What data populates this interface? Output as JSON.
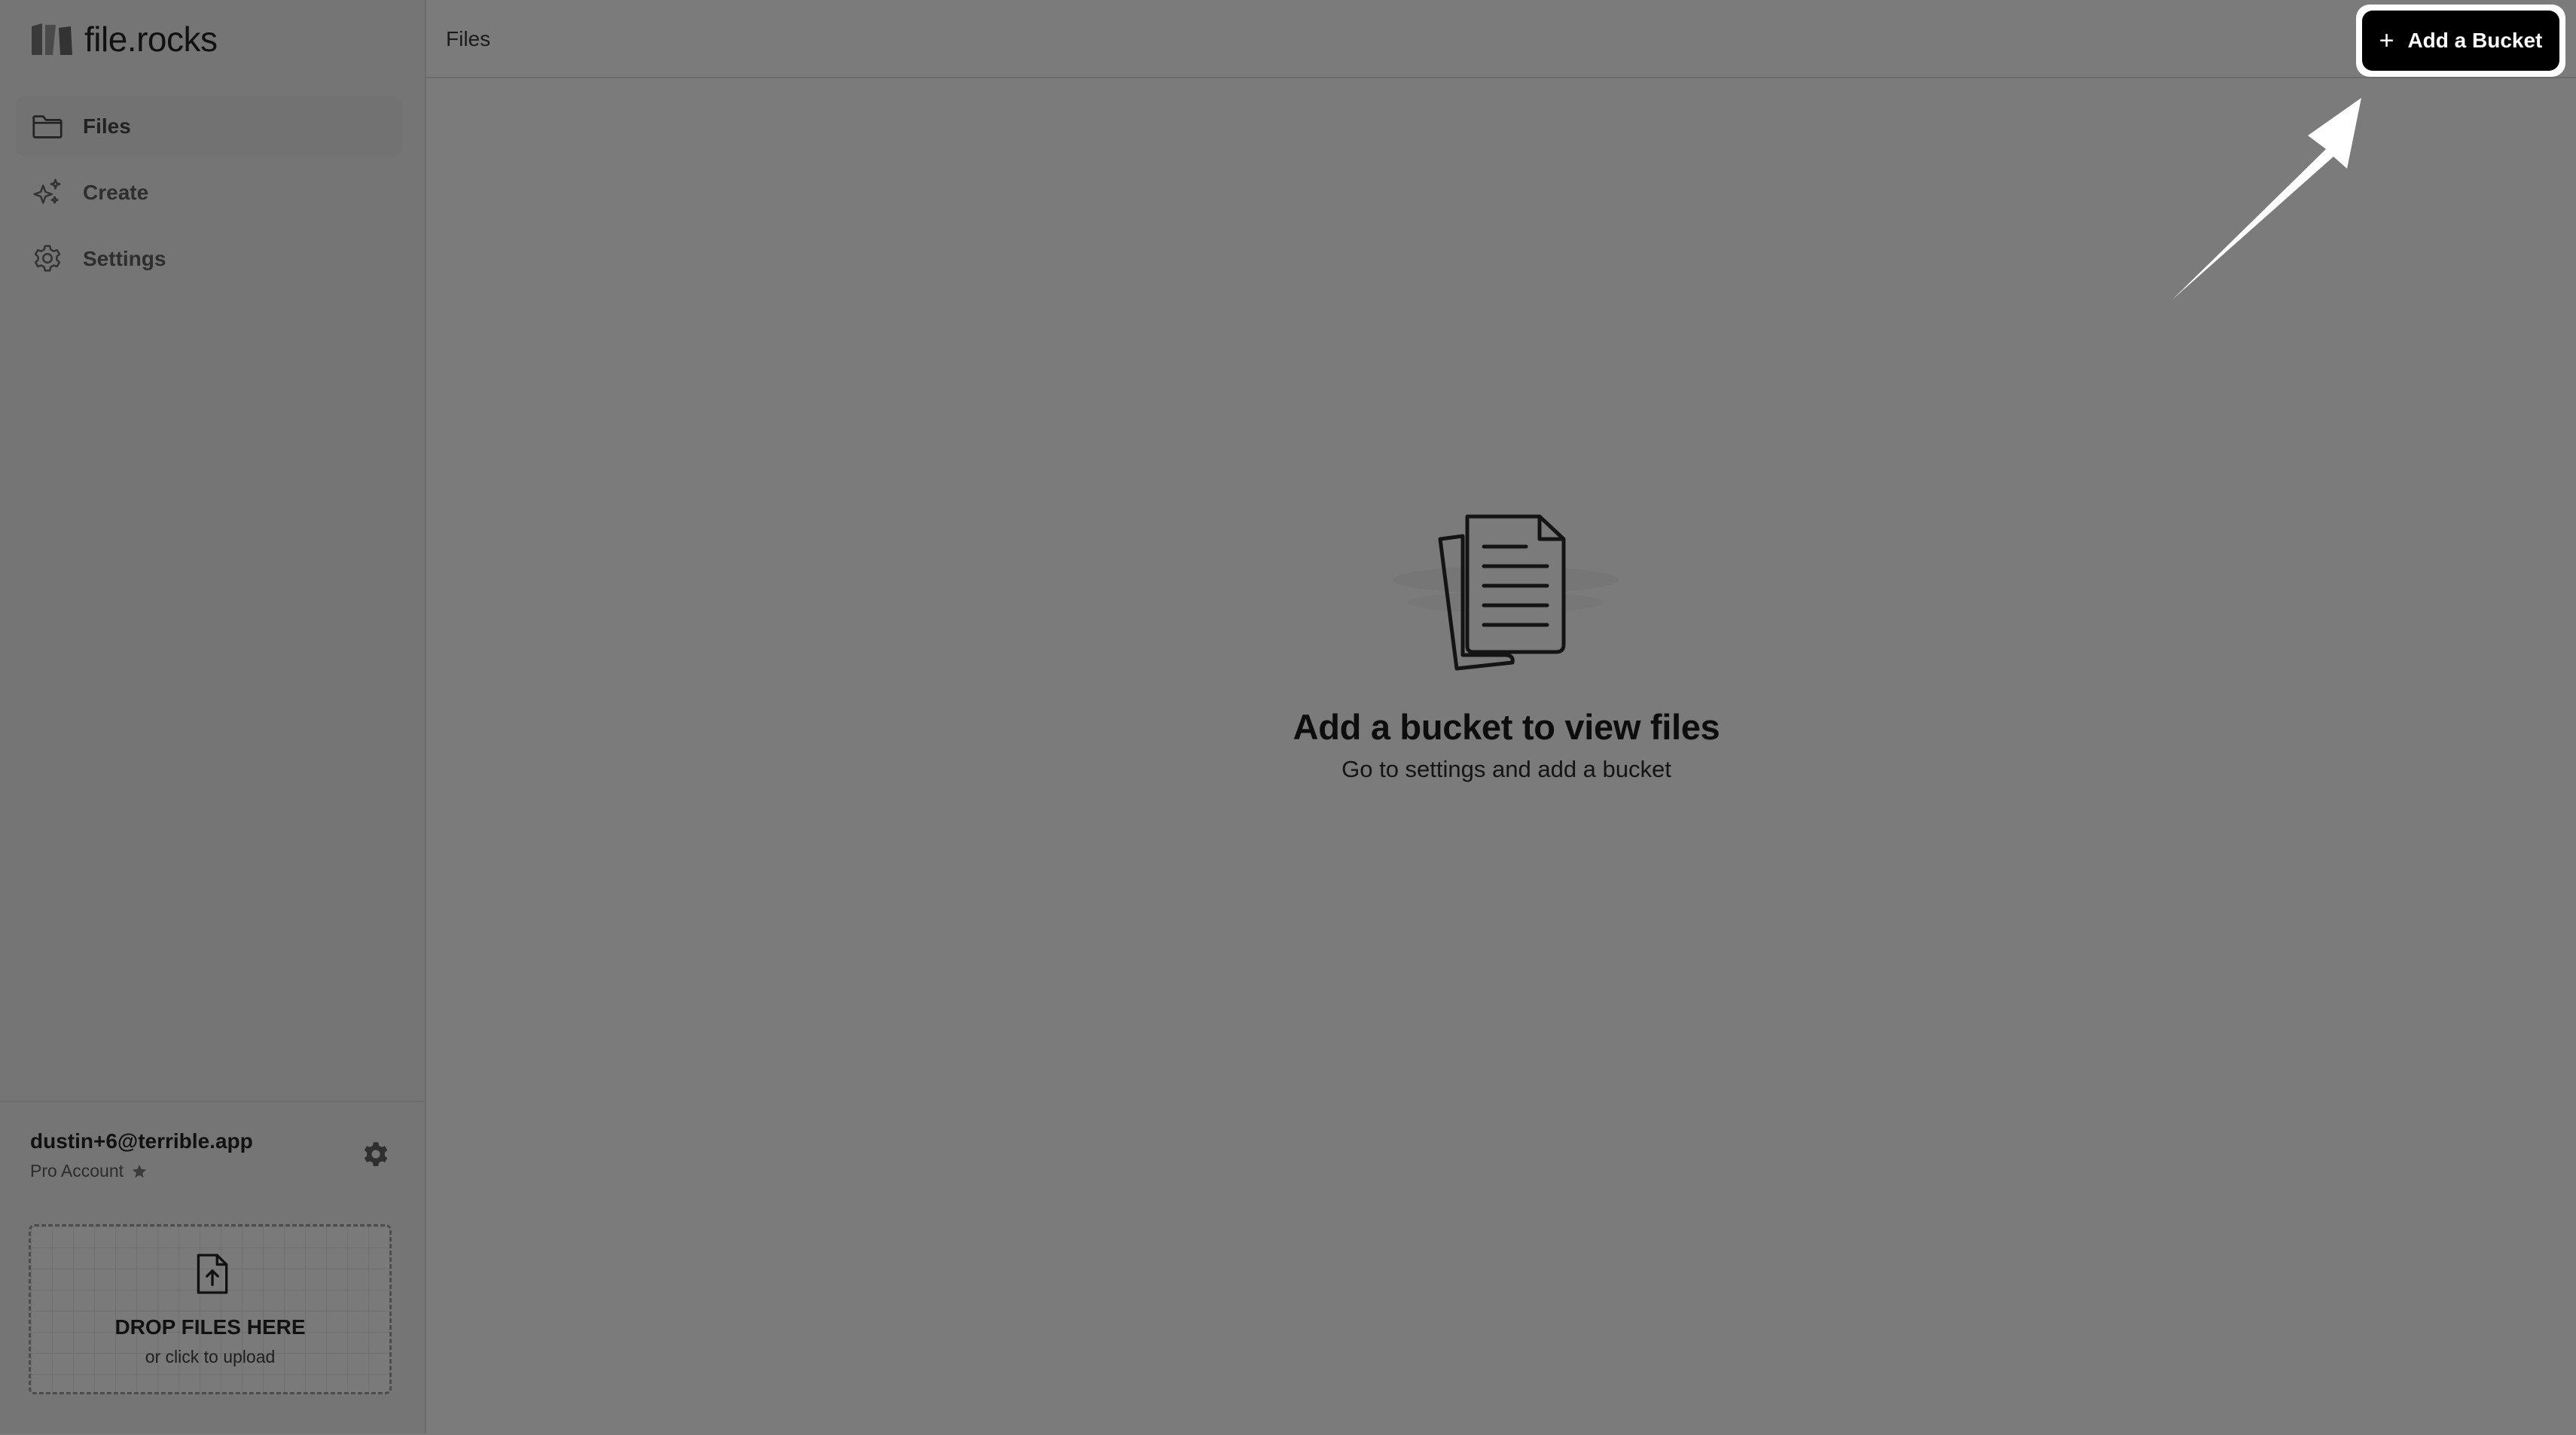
{
  "app": {
    "name": "file.rocks"
  },
  "sidebar": {
    "items": [
      {
        "label": "Files",
        "icon": "folder-icon",
        "active": true
      },
      {
        "label": "Create",
        "icon": "sparkles-icon",
        "active": false
      },
      {
        "label": "Settings",
        "icon": "gear-icon",
        "active": false
      }
    ]
  },
  "account": {
    "email": "dustin+6@terrible.app",
    "plan": "Pro Account",
    "plan_icon": "star-icon",
    "settings_icon": "gear-icon"
  },
  "dropzone": {
    "title": "DROP FILES HERE",
    "subtitle": "or click to upload",
    "icon": "file-upload-icon"
  },
  "header": {
    "breadcrumb": "Files",
    "add_button_label": "Add a Bucket",
    "add_button_icon": "plus-icon"
  },
  "empty_state": {
    "icon": "documents-icon",
    "heading": "Add a bucket to view files",
    "subtext": "Go to settings and add a bucket"
  },
  "annotation": {
    "icon": "arrow-icon"
  },
  "colors": {
    "overlay": "#7b7b7b",
    "button_bg": "#000000",
    "button_text": "#ffffff",
    "highlight": "#ffffff"
  }
}
